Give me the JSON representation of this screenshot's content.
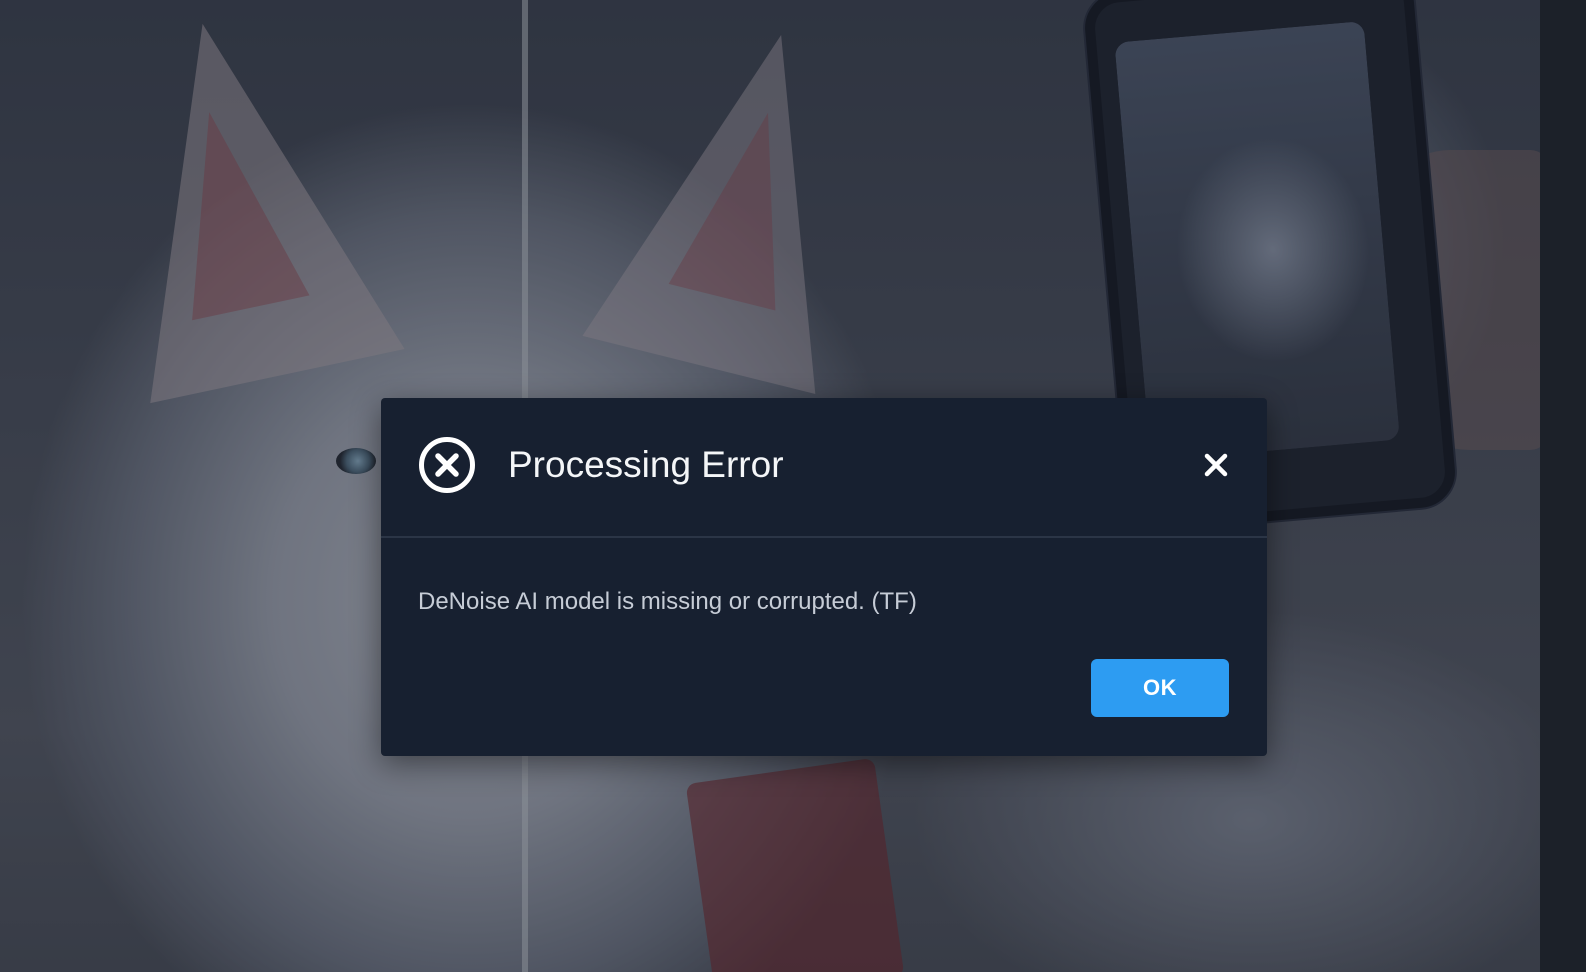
{
  "dialog": {
    "title": "Processing Error",
    "message": "DeNoise AI model is missing or corrupted. (TF)",
    "ok_label": "OK",
    "icon": "error-circle-x-icon",
    "close_icon": "close-icon"
  },
  "colors": {
    "dialog_background": "#172030",
    "primary_button": "#2d9cf2",
    "title_text": "#f4f6f8",
    "message_text": "#c6ccd6"
  }
}
